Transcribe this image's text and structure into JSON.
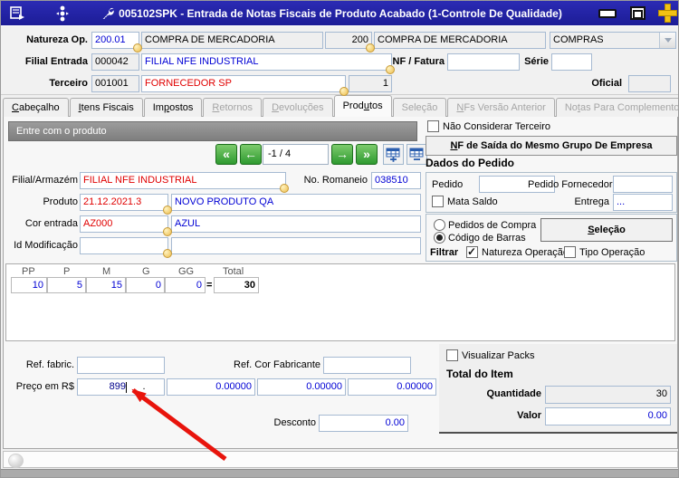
{
  "window": {
    "title": "005102SPK - Entrada de Notas Fiscais de Produto Acabado (1-Controle De Qualidade)"
  },
  "header": {
    "natureza": {
      "label": "Natureza Op.",
      "code": "200.01",
      "desc": "COMPRA DE MERCADORIA",
      "num": "200",
      "desc2": "COMPRA DE MERCADORIA",
      "tipo": "COMPRAS"
    },
    "filial": {
      "label": "Filial Entrada",
      "code": "000042",
      "desc": "FILIAL NFE INDUSTRIAL"
    },
    "nf": {
      "label": "NF / Fatura",
      "value": ""
    },
    "serie": {
      "label": "Série",
      "value": ""
    },
    "terceiro": {
      "label": "Terceiro",
      "code": "001001",
      "desc": "FORNECEDOR SP",
      "num": "1"
    },
    "oficial": {
      "label": "Oficial",
      "value": ""
    }
  },
  "tabs": [
    {
      "pre": "",
      "accel": "C",
      "post": "abeçalho",
      "state": "enabled"
    },
    {
      "pre": "",
      "accel": "I",
      "post": "tens Fiscais",
      "state": "enabled"
    },
    {
      "pre": "Im",
      "accel": "p",
      "post": "ostos",
      "state": "enabled"
    },
    {
      "pre": "",
      "accel": "R",
      "post": "etornos",
      "state": "disabled"
    },
    {
      "pre": "",
      "accel": "D",
      "post": "evoluções",
      "state": "disabled"
    },
    {
      "pre": "Prod",
      "accel": "u",
      "post": "tos",
      "state": "active"
    },
    {
      "pre": "Seleção",
      "accel": "",
      "post": "",
      "state": "disabled"
    },
    {
      "pre": "",
      "accel": "N",
      "post": "Fs Versão Anterior",
      "state": "disabled"
    },
    {
      "pre": "No",
      "accel": "t",
      "post": "as Para Complemento",
      "state": "disabled"
    }
  ],
  "produto_panel": {
    "title": "Entre com o produto",
    "nav": {
      "first": "«",
      "prev": "←",
      "counter": "-1 / 4",
      "next": "→",
      "last": "»"
    },
    "filial_armazem": {
      "label": "Filial/Armazém",
      "value": "FILIAL NFE INDUSTRIAL"
    },
    "romaneio": {
      "label": "No. Romaneio",
      "value": "038510"
    },
    "produto": {
      "label": "Produto",
      "code": "21.12.2021.3",
      "desc": "NOVO PRODUTO QA"
    },
    "cor": {
      "label": "Cor entrada",
      "code": "AZ000",
      "desc": "AZUL"
    },
    "id_mod": {
      "label": "Id Modificação",
      "code": "",
      "desc": ""
    },
    "grade": {
      "headers": [
        "PP",
        "P",
        "M",
        "G",
        "GG"
      ],
      "total_label": "Total",
      "values": [
        "10",
        "5",
        "15",
        "0",
        "0"
      ],
      "equals": "=",
      "total": "30"
    },
    "ref_fabric": {
      "label": "Ref. fabric.",
      "value": ""
    },
    "ref_cor": {
      "label": "Ref. Cor Fabricante",
      "value": ""
    },
    "preco": {
      "label": "Preço em R$",
      "int": "899",
      "sep": ".",
      "v2": "0.00000",
      "v3": "0.00000",
      "v4": "0.00000"
    },
    "desconto": {
      "label": "Desconto",
      "value": "0.00"
    }
  },
  "pedido_panel": {
    "nao_considerar": "Não Considerar Terceiro",
    "nf_saida": {
      "accel": "N",
      "post": "F de Saída do Mesmo Grupo De Empresa"
    },
    "title": "Dados do Pedido",
    "pedido": {
      "label": "Pedido",
      "value": ""
    },
    "pedido_fornecedor": {
      "label": "Pedido Fornecedor",
      "value": ""
    },
    "mata_saldo": "Mata Saldo",
    "entrega": {
      "label": "Entrega",
      "value": "..."
    },
    "radio_pedidos": "Pedidos de Compra",
    "radio_codigo": "Código de Barras",
    "selecao": {
      "accel": "S",
      "post": "eleção"
    },
    "filtrar": {
      "label": "Filtrar",
      "natureza": "Natureza Operação",
      "tipo": "Tipo Operação"
    }
  },
  "totais_panel": {
    "visualizar": "Visualizar Packs",
    "title": "Total do Item",
    "quantidade": {
      "label": "Quantidade",
      "value": "30"
    },
    "valor": {
      "label": "Valor",
      "value": "0.00"
    }
  },
  "colors": {
    "titlebar": "#2222AA",
    "accent_blue": "#0000D4",
    "accent_red": "#E00000",
    "arrow": "#E8140C"
  }
}
